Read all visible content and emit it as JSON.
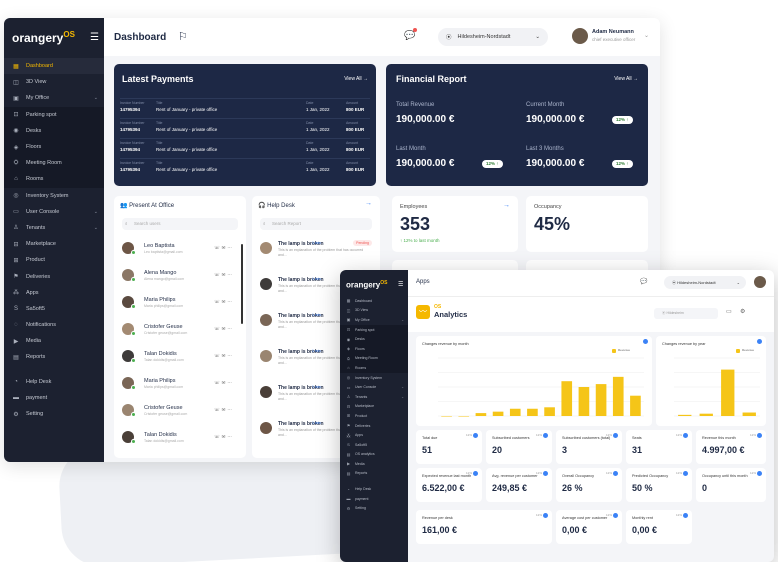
{
  "main": {
    "logo": "orangery",
    "logo_sup": "OS",
    "page_title": "Dashboard",
    "location": "Hildesheim-Nordstadt",
    "user_name": "Adam Neumann",
    "user_role": "chief executive officer",
    "nav": [
      {
        "label": "Dashboard",
        "icon": "grid-icon",
        "active": true
      },
      {
        "label": "3D View",
        "icon": "cube-icon"
      },
      {
        "label": "My Office",
        "icon": "office-icon",
        "expand": true
      },
      {
        "label": "Parking spot",
        "icon": "parking-icon",
        "sub": true
      },
      {
        "label": "Desks",
        "icon": "desk-icon",
        "sub": true
      },
      {
        "label": "Floors",
        "icon": "floor-icon",
        "sub": true
      },
      {
        "label": "Meeting Room",
        "icon": "meeting-icon",
        "sub": true
      },
      {
        "label": "Rooms",
        "icon": "room-icon",
        "sub": true
      },
      {
        "label": "Inventory System",
        "icon": "inventory-icon"
      },
      {
        "label": "User Console",
        "icon": "console-icon",
        "expand": true
      },
      {
        "label": "Tenants",
        "icon": "tenant-icon",
        "expand": true
      },
      {
        "label": "Marketplace",
        "icon": "market-icon"
      },
      {
        "label": "Product",
        "icon": "product-icon"
      },
      {
        "label": "Deliveries",
        "icon": "delivery-icon"
      },
      {
        "label": "Apps",
        "icon": "apps-icon"
      },
      {
        "label": "Sa5oft5",
        "icon": "saas-icon"
      },
      {
        "label": "Notifications",
        "icon": "bell-icon"
      },
      {
        "label": "Media",
        "icon": "media-icon"
      },
      {
        "label": "Reports",
        "icon": "report-icon"
      }
    ],
    "nav_bottom": [
      {
        "label": "Help Desk",
        "icon": "help-icon"
      },
      {
        "label": "payment",
        "icon": "card-icon"
      },
      {
        "label": "Setting",
        "icon": "gear-icon"
      }
    ]
  },
  "payments": {
    "title": "Latest Payments",
    "view_all": "View All →",
    "col_invoice": "Invoice Number",
    "col_title": "Title",
    "col_date": "Date",
    "col_amount": "Amount",
    "rows": [
      {
        "invoice": "14795394",
        "title": "Rent of January - private office",
        "date": "1 Jan, 2022",
        "amount": "800 EUR"
      },
      {
        "invoice": "14795394",
        "title": "Rent of January - private office",
        "date": "1 Jan, 2022",
        "amount": "800 EUR"
      },
      {
        "invoice": "14795394",
        "title": "Rent of January - private office",
        "date": "1 Jan, 2022",
        "amount": "800 EUR"
      },
      {
        "invoice": "14795394",
        "title": "Rent of January - private office",
        "date": "1 Jan, 2022",
        "amount": "800 EUR"
      }
    ]
  },
  "financial": {
    "title": "Financial Report",
    "view_all": "View All →",
    "items": [
      {
        "label": "Total Revenue",
        "value": "190,000.00 €",
        "badge": ""
      },
      {
        "label": "Current Month",
        "value": "190,000.00 €",
        "badge": "12% ↑"
      },
      {
        "label": "Last Month",
        "value": "190,000.00 €",
        "badge": "12% ↑"
      },
      {
        "label": "Last 3 Months",
        "value": "190,000.00 €",
        "badge": "12% ↑"
      }
    ]
  },
  "metrics": {
    "employees_label": "Employees",
    "employees_value": "353",
    "employees_sub": "↑ 12% to last month",
    "occupancy_label": "Occupancy",
    "occupancy_value": "45%"
  },
  "present": {
    "title": "Present At Office",
    "search_placeholder": "Search users",
    "people": [
      {
        "name": "Leo Baptista",
        "sub": "Leo baptista@gmail.com"
      },
      {
        "name": "Alena Mango",
        "sub": "Alena mango@gmail.com"
      },
      {
        "name": "Maria Philips",
        "sub": "Maria philips@gmail.com"
      },
      {
        "name": "Cristofer Geuse",
        "sub": "Cristofer geuse@gmail.com"
      },
      {
        "name": "Talan Dokidis",
        "sub": "Talan dokidis@gmail.com"
      },
      {
        "name": "Maria Philips",
        "sub": "Maria philips@gmail.com"
      },
      {
        "name": "Cristofer Geuse",
        "sub": "Cristofer geuse@gmail.com"
      },
      {
        "name": "Talan Dokidis",
        "sub": "Talan dokidis@gmail.com"
      }
    ]
  },
  "helpdesk": {
    "title": "Help Desk",
    "search_placeholder": "Search Report",
    "tickets": [
      {
        "title": "The lamp is broken",
        "time": "1 min",
        "desc": "This is an explanation of the problem that has occurred and...",
        "badge": "Pending"
      },
      {
        "title": "The lamp is broken",
        "time": "1 min",
        "desc": "This is an explanation of the problem that has occurred and...",
        "badge": ""
      },
      {
        "title": "The lamp is broken",
        "time": "1 min",
        "desc": "This is an explanation of the problem that has occurred and...",
        "badge": ""
      },
      {
        "title": "The lamp is broken",
        "time": "1 min",
        "desc": "This is an explanation of the problem that has occurred and...",
        "badge": ""
      },
      {
        "title": "The lamp is broken",
        "time": "1 min",
        "desc": "This is an explanation of the problem that has occurred and...",
        "badge": ""
      },
      {
        "title": "The lamp is broken",
        "time": "1 min",
        "desc": "This is an explanation of the problem that has occurred and...",
        "badge": ""
      }
    ]
  },
  "analytics": {
    "logo": "orangery",
    "logo_sup": "OS",
    "page_title": "Apps",
    "location": "Hildesheim-Nordstadt",
    "brand_small": "OS",
    "brand_big": "Analytics",
    "select_placeholder": "Hildesheim",
    "nav": [
      "Dashboard",
      "3D View",
      "My Office",
      "Parking spot",
      "Desks",
      "Floors",
      "Meeting Room",
      "Rooms",
      "Inventory System",
      "User Console",
      "Tenants",
      "Marketplace",
      "Product",
      "Deliveries",
      "Apps",
      "Sa5oft5",
      "OS analytics",
      "Media",
      "Reports"
    ],
    "nav_bottom": [
      "Help Desk",
      "payment",
      "Setting"
    ],
    "chart1_title": "Changes revenue by month",
    "chart2_title": "Changes revenue by year",
    "legend": "Revenue",
    "kpis": [
      {
        "title": "Total due",
        "value": "51",
        "pct": "12%"
      },
      {
        "title": "Subscribed customers",
        "value": "20",
        "pct": "12%"
      },
      {
        "title": "Subscribed customers (total)",
        "value": "3",
        "pct": "12%"
      },
      {
        "title": "Seats",
        "value": "31",
        "pct": "12%"
      },
      {
        "title": "Revenue this month",
        "value": "4.997,00 €",
        "pct": "12%"
      },
      {
        "title": "Expected revenue last month",
        "value": "6.522,00 €",
        "pct": "12%"
      },
      {
        "title": "Avg. revenue per customer",
        "value": "249,85 €",
        "pct": "12%"
      },
      {
        "title": "Overall Occupancy",
        "value": "26 %",
        "pct": "12%"
      },
      {
        "title": "Predicted Occupancy",
        "value": "50 %",
        "pct": "12%"
      },
      {
        "title": "Occupancy until this month",
        "value": "0",
        "pct": "12%"
      },
      {
        "title": "Revenue per desk",
        "value": "161,00 €",
        "pct": "12%"
      },
      {
        "title": "Average cost per customer",
        "value": "0,00 €",
        "pct": "12%"
      },
      {
        "title": "Monthly rent",
        "value": "0,00 €",
        "pct": "12%"
      }
    ]
  },
  "chart_data": [
    {
      "type": "bar",
      "title": "Changes revenue by month",
      "series": [
        {
          "name": "Revenue",
          "values": [
            0,
            0,
            0.4,
            0.6,
            1.0,
            1.0,
            1.2,
            4.8,
            4.0,
            4.4,
            5.4,
            2.8
          ]
        }
      ],
      "ylim": [
        0,
        8
      ]
    },
    {
      "type": "bar",
      "title": "Changes revenue by year",
      "series": [
        {
          "name": "Revenue",
          "values": [
            0.2,
            0.4,
            8.0,
            0.6
          ]
        }
      ],
      "ylim": [
        0,
        10
      ]
    }
  ]
}
